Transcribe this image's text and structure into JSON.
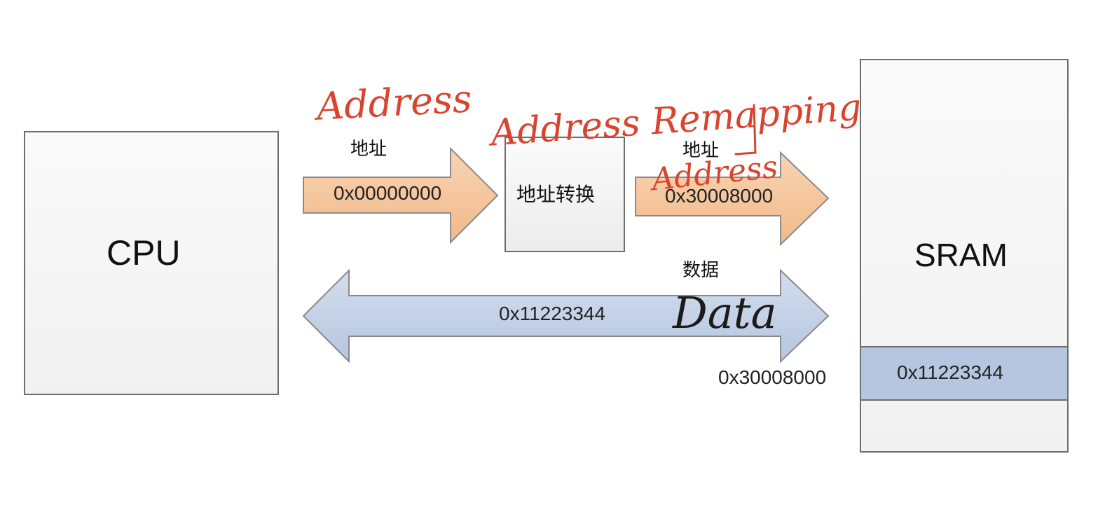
{
  "cpu": {
    "label": "CPU"
  },
  "address_converter": {
    "label": "地址转换"
  },
  "sram": {
    "label": "SRAM",
    "cell_value": "0x11223344",
    "cell_address": "0x30008000"
  },
  "arrow_address_in": {
    "label": "地址",
    "value": "0x00000000"
  },
  "arrow_address_out": {
    "label": "地址",
    "value": "0x30008000"
  },
  "arrow_data": {
    "label": "数据",
    "value": "0x11223344"
  },
  "handwritten": {
    "address_left": "Address",
    "address_remapping": "Address Remapping",
    "address_right": "Address",
    "data": "Data"
  },
  "colors": {
    "address_arrow_fill": "#f6c79f",
    "data_arrow_fill": "#c4d2e8",
    "sram_cell_fill": "#b6c6e0",
    "handwriting_red": "#d8452f",
    "box_border": "#6d6d6d"
  }
}
